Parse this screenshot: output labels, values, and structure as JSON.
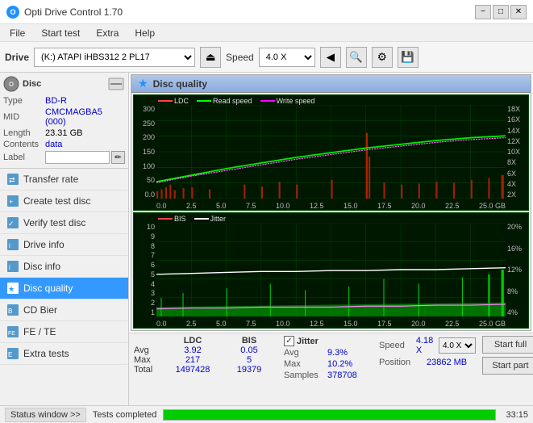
{
  "titlebar": {
    "icon": "O",
    "title": "Opti Drive Control 1.70",
    "min": "−",
    "max": "□",
    "close": "✕"
  },
  "menubar": {
    "items": [
      "File",
      "Start test",
      "Extra",
      "Help"
    ]
  },
  "toolbar": {
    "drive_label": "Drive",
    "drive_value": "(K:) ATAPI iHBS312  2 PL17",
    "speed_label": "Speed",
    "speed_value": "4.0 X",
    "eject_icon": "⏏",
    "refresh_icon": "↻"
  },
  "disc_panel": {
    "header": "Disc",
    "type_label": "Type",
    "type_value": "BD-R",
    "mid_label": "MID",
    "mid_value": "CMCMAGBA5 (000)",
    "length_label": "Length",
    "length_value": "23.31 GB",
    "contents_label": "Contents",
    "contents_value": "data",
    "label_label": "Label",
    "label_value": "",
    "label_placeholder": ""
  },
  "nav": {
    "items": [
      {
        "id": "transfer-rate",
        "label": "Transfer rate",
        "active": false
      },
      {
        "id": "create-test-disc",
        "label": "Create test disc",
        "active": false
      },
      {
        "id": "verify-test-disc",
        "label": "Verify test disc",
        "active": false
      },
      {
        "id": "drive-info",
        "label": "Drive info",
        "active": false
      },
      {
        "id": "disc-info",
        "label": "Disc info",
        "active": false
      },
      {
        "id": "disc-quality",
        "label": "Disc quality",
        "active": true
      },
      {
        "id": "cd-bier",
        "label": "CD Bier",
        "active": false
      },
      {
        "id": "fe-te",
        "label": "FE / TE",
        "active": false
      },
      {
        "id": "extra-tests",
        "label": "Extra tests",
        "active": false
      }
    ]
  },
  "quality_panel": {
    "title": "Disc quality",
    "icon": "★",
    "chart1": {
      "legend": [
        {
          "label": "LDC",
          "color": "#ff0000"
        },
        {
          "label": "Read speed",
          "color": "#00ff00"
        },
        {
          "label": "Write speed",
          "color": "#ff00ff"
        }
      ],
      "y_left_labels": [
        "300",
        "250",
        "200",
        "150",
        "100",
        "50",
        "0.0"
      ],
      "y_right_labels": [
        "18X",
        "16X",
        "14X",
        "12X",
        "10X",
        "8X",
        "6X",
        "4X",
        "2X"
      ],
      "x_labels": [
        "0.0",
        "2.5",
        "5.0",
        "7.5",
        "10.0",
        "12.5",
        "15.0",
        "17.5",
        "20.0",
        "22.5",
        "25.0 GB"
      ]
    },
    "chart2": {
      "legend": [
        {
          "label": "BIS",
          "color": "#ff0000"
        },
        {
          "label": "Jitter",
          "color": "#ffffff"
        }
      ],
      "y_left_labels": [
        "10",
        "9",
        "8",
        "7",
        "6",
        "5",
        "4",
        "3",
        "2",
        "1"
      ],
      "y_right_labels": [
        "20%",
        "16%",
        "12%",
        "8%",
        "4%"
      ],
      "x_labels": [
        "0.0",
        "2.5",
        "5.0",
        "7.5",
        "10.0",
        "12.5",
        "15.0",
        "17.5",
        "20.0",
        "22.5",
        "25.0 GB"
      ]
    }
  },
  "stats": {
    "columns": [
      "LDC",
      "BIS"
    ],
    "rows": [
      {
        "label": "Avg",
        "ldc": "3.92",
        "bis": "0.05"
      },
      {
        "label": "Max",
        "ldc": "217",
        "bis": "5"
      },
      {
        "label": "Total",
        "ldc": "1497428",
        "bis": "19379"
      }
    ],
    "jitter_checked": true,
    "jitter_label": "Jitter",
    "jitter_rows": [
      {
        "label": "Avg",
        "val": "9.3%"
      },
      {
        "label": "Max",
        "val": "10.2%"
      },
      {
        "label": "Samples",
        "val": "378708"
      }
    ],
    "speed_label": "Speed",
    "speed_value": "4.18 X",
    "speed_select": "4.0 X",
    "position_label": "Position",
    "position_value": "23862 MB",
    "start_full_label": "Start full",
    "start_part_label": "Start part"
  },
  "statusbar": {
    "window_btn": "Status window >>",
    "progress": 100,
    "complete_text": "Tests completed",
    "time": "33:15"
  }
}
